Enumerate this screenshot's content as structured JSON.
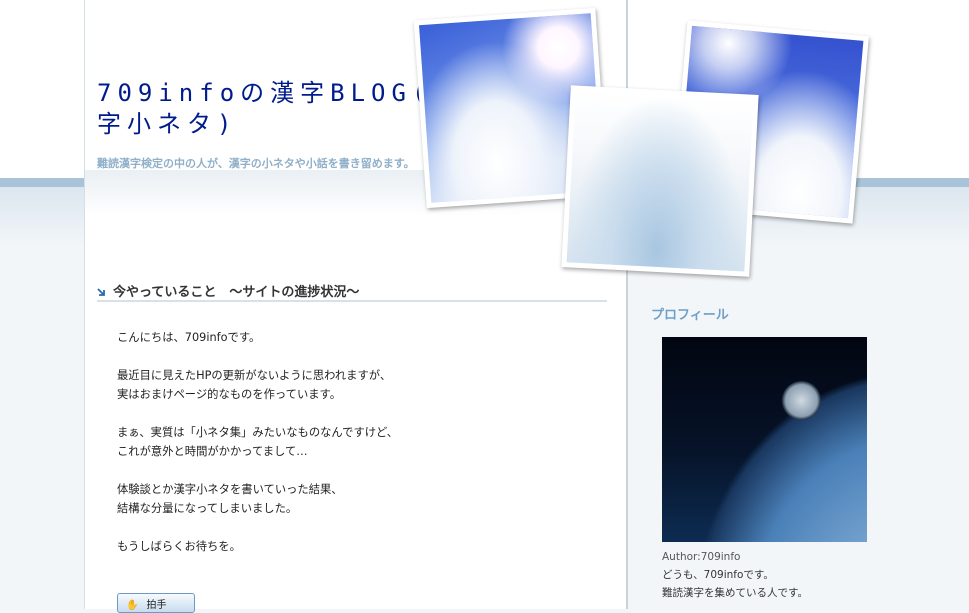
{
  "blog": {
    "title": "709infoの漢字BLOG(気ままに漢字小ネタ)",
    "subtitle": "難読漢字検定の中の人が、漢字の小ネタや小話を書き留めます。"
  },
  "entry": {
    "title": "今やっていること　〜サイトの進捗状況〜",
    "paragraphs": [
      "こんにちは、709infoです。",
      "最近目に見えたHPの更新がないように思われますが、\n実はおまけページ的なものを作っています。",
      "まぁ、実質は「小ネタ集」みたいなものなんですけど、\nこれが意外と時間がかかってまして…",
      "体験談とか漢字小ネタを書いていった結果、\n結構な分量になってしまいました。",
      "もうしばらくお待ちを。"
    ],
    "clap_label": "拍手"
  },
  "sidebar": {
    "profile_heading": "プロフィール",
    "author": "Author:709info",
    "bio_line1": "どうも、709infoです。",
    "bio_line2": "難読漢字を集めている人です。"
  },
  "icons": {
    "entry_arrow": "arrow-down-right-icon",
    "clap": "clapping-hands-icon"
  },
  "colors": {
    "title": "#001c8c",
    "subtitle": "#8fb0c8",
    "sidebar_heading": "#6f9fc9",
    "accent_band": "#a9c3d8"
  }
}
